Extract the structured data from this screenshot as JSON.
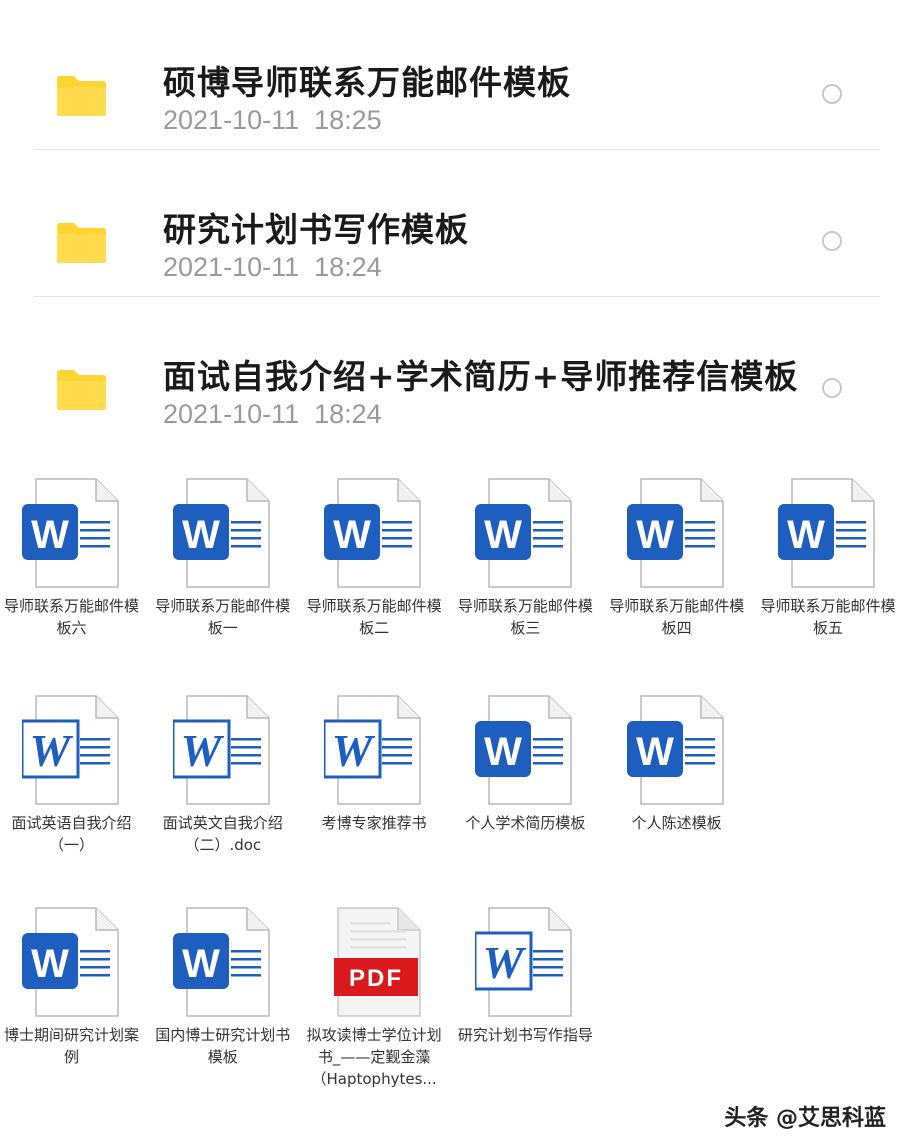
{
  "folders": [
    {
      "name": "硕博导师联系万能邮件模板",
      "date": "2021-10-11  18:25"
    },
    {
      "name": "研究计划书写作模板",
      "date": "2021-10-11  18:24"
    },
    {
      "name": "面试自我介绍+学术简历+导师推荐信模板",
      "date": "2021-10-11  18:24"
    }
  ],
  "files": [
    {
      "name": "导师联系万能邮件模板六",
      "icon": "word-icon"
    },
    {
      "name": "导师联系万能邮件模板一",
      "icon": "word-icon"
    },
    {
      "name": "导师联系万能邮件模板二",
      "icon": "word-icon"
    },
    {
      "name": "导师联系万能邮件模板三",
      "icon": "word-icon"
    },
    {
      "name": "导师联系万能邮件模板四",
      "icon": "word-icon"
    },
    {
      "name": "导师联系万能邮件模板五",
      "icon": "word-icon"
    },
    {
      "name": "面试英语自我介绍（一）",
      "icon": "word-classic-icon"
    },
    {
      "name": "面试英文自我介绍（二）.doc",
      "icon": "word-classic-icon"
    },
    {
      "name": "考博专家推荐书",
      "icon": "word-classic-icon"
    },
    {
      "name": "个人学术简历模板",
      "icon": "word-icon"
    },
    {
      "name": "个人陈述模板",
      "icon": "word-icon"
    },
    {
      "name": "博士期间研究计划案例",
      "icon": "word-icon"
    },
    {
      "name": "国内博士研究计划书模板",
      "icon": "word-icon"
    },
    {
      "name": "拟攻读博士学位计划书_——定觐金藻（Haptophytes...",
      "icon": "pdf-icon"
    },
    {
      "name": "研究计划书写作指导",
      "icon": "word-classic-icon"
    }
  ],
  "pdf_label": "PDF",
  "word_letter": "W",
  "watermark": "头条 @艾思科蓝",
  "colors": {
    "folder": "#FFD330",
    "word": "#1E5EBF",
    "pdf": "#D9191C"
  }
}
